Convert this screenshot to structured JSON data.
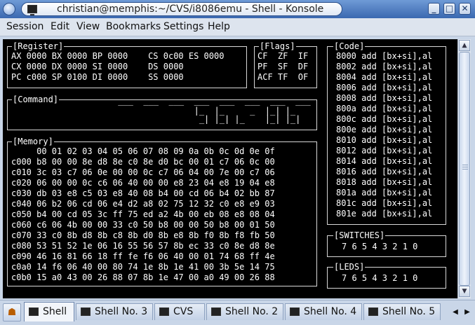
{
  "window": {
    "title": "christian@memphis:~/CVS/i8086emu - Shell - Konsole",
    "buttons": {
      "minimize": "_",
      "maximize": "□",
      "close": "✕"
    }
  },
  "menubar": [
    "Session",
    "Edit",
    "View",
    "Bookmarks",
    "Settings",
    "Help"
  ],
  "terminal": {
    "register": {
      "title": "[Register]",
      "lines": [
        "AX 0000 BX 0000 BP 0000    CS 0c00 ES 0000",
        "CX 0000 DX 0000 SI 0000    DS 0000",
        "PC c000 SP 0100 DI 0000    SS 0000"
      ]
    },
    "flags": {
      "title": "[Flags]",
      "lines": [
        "CF  ZF  IF",
        "PF  SF  DF",
        "ACF TF  OF"
      ]
    },
    "code": {
      "title": "[Code]",
      "lines": [
        "8000 add [bx+si],al",
        "8002 add [bx+si],al",
        "8004 add [bx+si],al",
        "8006 add [bx+si],al",
        "8008 add [bx+si],al",
        "800a add [bx+si],al",
        "800c add [bx+si],al",
        "800e add [bx+si],al",
        "8010 add [bx+si],al",
        "8012 add [bx+si],al",
        "8014 add [bx+si],al",
        "8016 add [bx+si],al",
        "8018 add [bx+si],al",
        "801a add [bx+si],al",
        "801c add [bx+si],al",
        "801e add [bx+si],al"
      ]
    },
    "command": {
      "title": "[Command]",
      "display_top": " ___  ___  ___  ___  ___  ___  ___  ___",
      "display_mid": "                |_  |_     _  |_| |_",
      "display_bot": "                 _| |_| |_    |_| |_|"
    },
    "memory": {
      "title": "[Memory]",
      "header": "     00 01 02 03 04 05 06 07 08 09 0a 0b 0c 0d 0e 0f",
      "rows": [
        "c000 b8 00 00 8e d8 8e c0 8e d0 bc 00 01 c7 06 0c 00",
        "c010 3c 03 c7 06 0e 00 00 0c c7 06 04 00 7e 00 c7 06",
        "c020 06 00 00 0c c6 06 40 00 00 e8 23 04 e8 19 04 e8",
        "c030 db 03 e8 c5 03 e8 40 08 b4 00 cd 06 b4 02 bb 87",
        "c040 06 b2 06 cd 06 e4 d2 a8 02 75 12 32 c0 e8 e9 03",
        "c050 b4 00 cd 05 3c ff 75 ed a2 4b 00 eb 08 e8 08 04",
        "c060 c6 06 4b 00 00 33 c0 50 b8 00 00 50 b8 00 01 50",
        "c070 33 c0 8b d8 8b c8 8b d0 8b e8 8b f0 8b f8 fb 50",
        "c080 53 51 52 1e 06 16 55 56 57 8b ec 33 c0 8e d8 8e",
        "c090 46 16 81 66 18 ff fe f6 06 40 00 01 74 68 ff 4e",
        "c0a0 14 f6 06 40 00 80 74 1e 8b 1e 41 00 3b 5e 14 75",
        "c0b0 15 a0 43 00 26 88 07 8b 1e 47 00 a0 49 00 26 88"
      ]
    },
    "switches": {
      "title": "[SWITCHES]",
      "line": "7 6 5 4 3 2 1 0"
    },
    "leds": {
      "title": "[LEDS]",
      "line": "7 6 5 4 3 2 1 0"
    }
  },
  "tabs": [
    {
      "label": "Shell",
      "active": true
    },
    {
      "label": "Shell No. 3",
      "active": false
    },
    {
      "label": "CVS",
      "active": false
    },
    {
      "label": "Shell No. 2",
      "active": false
    },
    {
      "label": "Shell No. 4",
      "active": false
    },
    {
      "label": "Shell No. 5",
      "active": false
    }
  ],
  "colors": {
    "terminal_bg": "#000000",
    "terminal_fg": "#ffffff",
    "titlebar": "#4a78bf"
  }
}
